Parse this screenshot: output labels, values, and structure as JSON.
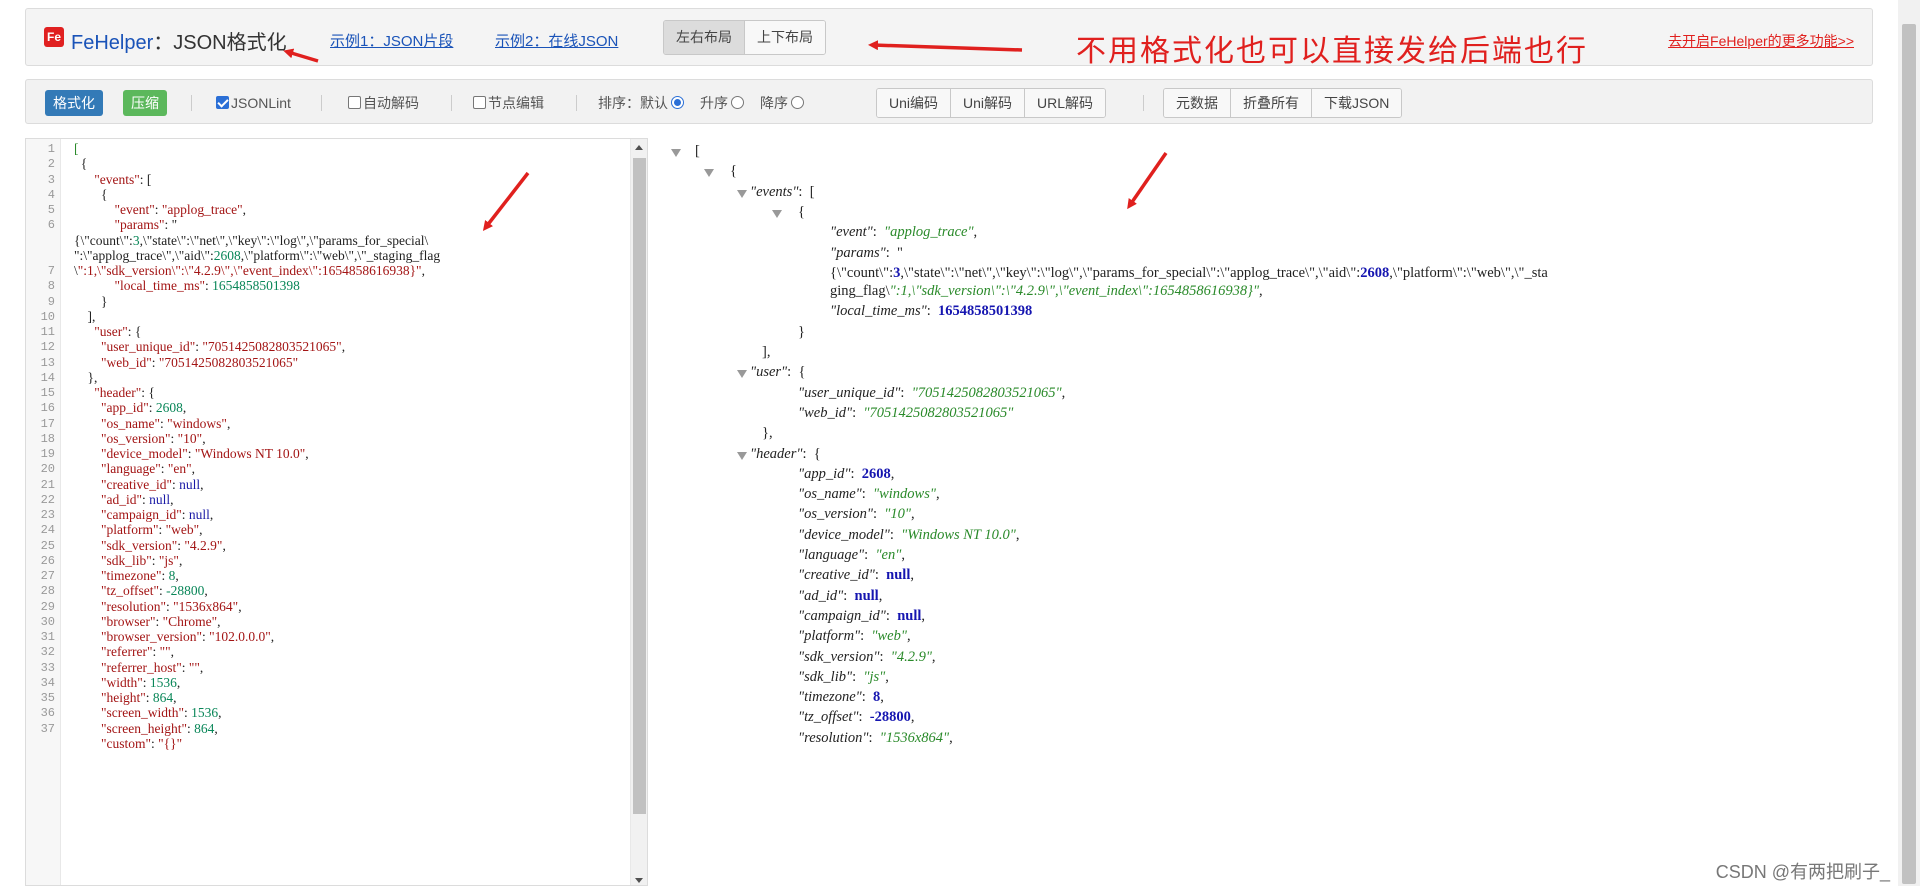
{
  "header": {
    "logo_letter": "Fe",
    "brand_name": "FeHelper",
    "brand_suffix": "：JSON格式化",
    "example1": "示例1：JSON片段",
    "example2": "示例2：在线JSON",
    "layout_lr": "左右布局",
    "layout_tb": "上下布局",
    "annotation": "不用格式化也可以直接发给后端也行",
    "more_link": "去开启FeHelper的更多功能>>"
  },
  "toolbar": {
    "format": "格式化",
    "compress": "压缩",
    "jsonlint": "JSONLint",
    "auto_decode": "自动解码",
    "node_edit": "节点编辑",
    "sort_label": "排序：",
    "sort_default": "默认",
    "sort_asc": "升序",
    "sort_desc": "降序",
    "uni_encode": "Uni编码",
    "uni_decode": "Uni解码",
    "url_decode": "URL解码",
    "meta": "元数据",
    "fold_all": "折叠所有",
    "download": "下载JSON",
    "jsonlint_checked": true,
    "auto_decode_checked": false,
    "node_edit_checked": false,
    "sort_selected": "默认"
  },
  "editor": {
    "line_numbers": [
      "1",
      "2",
      "3",
      "4",
      "5",
      "6",
      "",
      "",
      "7",
      "8",
      "9",
      "10",
      "11",
      "12",
      "13",
      "14",
      "15",
      "16",
      "17",
      "18",
      "19",
      "20",
      "21",
      "22",
      "23",
      "24",
      "25",
      "26",
      "27",
      "28",
      "29",
      "30",
      "31",
      "32",
      "33",
      "34",
      "35",
      "36",
      "37"
    ],
    "lines": [
      "[",
      "  {",
      "      \"events\": [",
      "        {",
      "            \"event\": \"applog_trace\",",
      "            \"params\": \"",
      "{\\\"count\\\":3,\\\"state\\\":\\\"net\\\",\\\"key\\\":\\\"log\\\",\\\"params_for_special\\",
      "\":\\\"applog_trace\\\",\\\"aid\\\":2608,\\\"platform\\\":\\\"web\\\",\\\"_staging_flag",
      "\\\":1,\\\"sdk_version\\\":\\\"4.2.9\\\",\\\"event_index\\\":1654858616938}\",",
      "            \"local_time_ms\": 1654858501398",
      "        }",
      "    ],",
      "      \"user\": {",
      "        \"user_unique_id\": \"7051425082803521065\",",
      "        \"web_id\": \"7051425082803521065\"",
      "    },",
      "      \"header\": {",
      "        \"app_id\": 2608,",
      "        \"os_name\": \"windows\",",
      "        \"os_version\": \"10\",",
      "        \"device_model\": \"Windows NT 10.0\",",
      "        \"language\": \"en\",",
      "        \"creative_id\": null,",
      "        \"ad_id\": null,",
      "        \"campaign_id\": null,",
      "        \"platform\": \"web\",",
      "        \"sdk_version\": \"4.2.9\",",
      "        \"sdk_lib\": \"js\",",
      "        \"timezone\": 8,",
      "        \"tz_offset\": -28800,",
      "        \"resolution\": \"1536x864\",",
      "        \"browser\": \"Chrome\",",
      "        \"browser_version\": \"102.0.0.0\",",
      "        \"referrer\": \"\",",
      "        \"referrer_host\": \"\",",
      "        \"width\": 1536,",
      "        \"height\": 864,",
      "        \"screen_width\": 1536,",
      "        \"screen_height\": 864,",
      "        \"custom\": \"{}\""
    ]
  },
  "tree": {
    "lines": [
      "[",
      "{",
      "\"events\":  [",
      "{",
      "\"event\":  \"applog_trace\",",
      "\"params\":  \"",
      "{\\\"count\\\":3,\\\"state\\\":\\\"net\\\",\\\"key\\\":\\\"log\\\",\\\"params_for_special\\\":\\\"applog_trace\\\",\\\"aid\\\":2608,\\\"platform\\\":\\\"web\\\",\\\"_sta",
      "ging_flag\\\":1,\\\"sdk_version\\\":\\\"4.2.9\\\",\\\"event_index\\\":1654858616938}\",",
      "\"local_time_ms\":  1654858501398",
      "}",
      "],",
      "\"user\":  {",
      "\"user_unique_id\":  \"7051425082803521065\",",
      "\"web_id\":  \"7051425082803521065\"",
      "},",
      "\"header\":  {",
      "\"app_id\":  2608,",
      "\"os_name\":  \"windows\",",
      "\"os_version\":  \"10\",",
      "\"device_model\":  \"Windows NT 10.0\",",
      "\"language\":  \"en\",",
      "\"creative_id\":  null,",
      "\"ad_id\":  null,",
      "\"campaign_id\":  null,",
      "\"platform\":  \"web\",",
      "\"sdk_version\":  \"4.2.9\",",
      "\"sdk_lib\":  \"js\",",
      "\"timezone\":  8,",
      "\"tz_offset\":  -28800,",
      "\"resolution\":  \"1536x864\","
    ]
  },
  "watermark": "CSDN @有两把刷子_",
  "colors": {
    "green_button": "#5cb85c",
    "blue_button": "#337ab7",
    "annotation_red": "#e0201e"
  }
}
